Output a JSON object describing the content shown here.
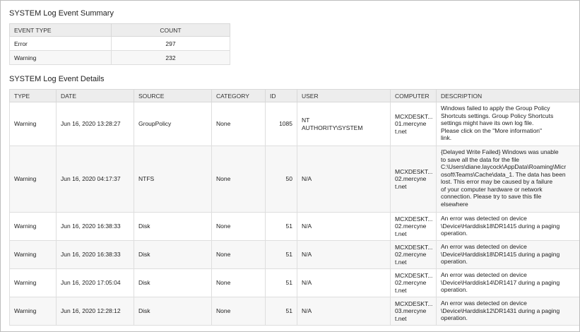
{
  "summary": {
    "title": "SYSTEM Log Event Summary",
    "columns": {
      "type": "EVENT TYPE",
      "count": "COUNT"
    },
    "rows": [
      {
        "type": "Error",
        "count": "297"
      },
      {
        "type": "Warning",
        "count": "232"
      }
    ]
  },
  "details": {
    "title": "SYSTEM Log Event Details",
    "columns": {
      "type": "TYPE",
      "date": "DATE",
      "source": "SOURCE",
      "category": "CATEGORY",
      "id": "ID",
      "user": "USER",
      "computer": "COMPUTER",
      "description": "DESCRIPTION"
    },
    "rows": [
      {
        "type": "Warning",
        "date": "Jun 16, 2020 13:28:27",
        "source": "GroupPolicy",
        "category": "None",
        "id": "1085",
        "user": "NT\nAUTHORITY\\SYSTEM",
        "computer": "MCXDESKT...\n01.mercyne\nt.net",
        "description": "Windows failed to apply the Group Policy\nShortcuts settings. Group Policy Shortcuts\nsettings might have its own log file.\nPlease click on the \"More information\"\nlink."
      },
      {
        "type": "Warning",
        "date": "Jun 16, 2020 04:17:37",
        "source": "NTFS",
        "category": "None",
        "id": "50",
        "user": "N/A",
        "computer": "MCXDESKT...\n02.mercyne\nt.net",
        "description": "{Delayed Write Failed} Windows was unable\nto save all the data for the file\nC:\\Users\\diane.laycock\\AppData\\Roaming\\Micr\nosoft\\Teams\\Cache\\data_1. The data has been\nlost. This error may be caused by a failure\nof your computer hardware or network\nconnection. Please try to save this file\nelsewhere"
      },
      {
        "type": "Warning",
        "date": "Jun 16, 2020 16:38:33",
        "source": "Disk",
        "category": "None",
        "id": "51",
        "user": "N/A",
        "computer": "MCXDESKT...\n02.mercyne\nt.net",
        "description": "An error was detected on device\n\\Device\\Harddisk18\\DR1415 during a paging\noperation."
      },
      {
        "type": "Warning",
        "date": "Jun 16, 2020 16:38:33",
        "source": "Disk",
        "category": "None",
        "id": "51",
        "user": "N/A",
        "computer": "MCXDESKT...\n02.mercyne\nt.net",
        "description": "An error was detected on device\n\\Device\\Harddisk18\\DR1415 during a paging\noperation."
      },
      {
        "type": "Warning",
        "date": "Jun 16, 2020 17:05:04",
        "source": "Disk",
        "category": "None",
        "id": "51",
        "user": "N/A",
        "computer": "MCXDESKT...\n02.mercyne\nt.net",
        "description": "An error was detected on device\n\\Device\\Harddisk14\\DR1417 during a paging\noperation."
      },
      {
        "type": "Warning",
        "date": "Jun 16, 2020 12:28:12",
        "source": "Disk",
        "category": "None",
        "id": "51",
        "user": "N/A",
        "computer": "MCXDESKT...\n03.mercyne\nt.net",
        "description": "An error was detected on device\n\\Device\\Harddisk12\\DR1431 during a paging\noperation."
      }
    ]
  }
}
